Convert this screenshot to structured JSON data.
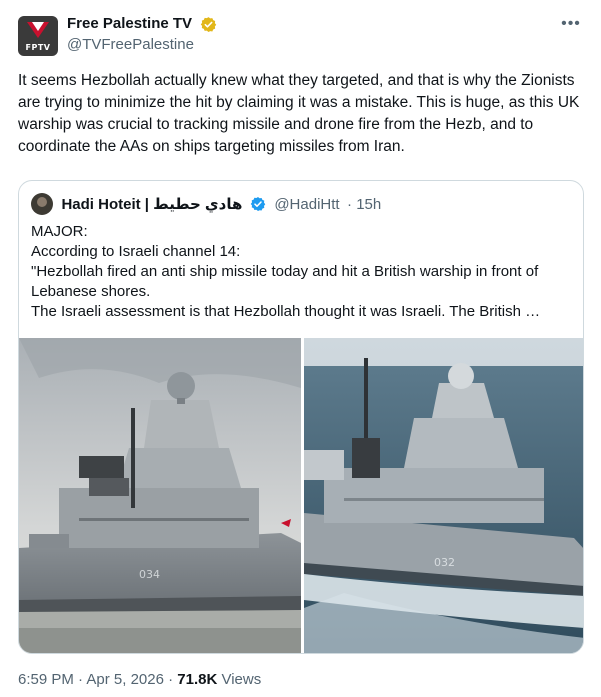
{
  "author": {
    "display_name": "Free Palestine TV",
    "handle": "@TVFreePalestine",
    "avatar_label": "FPTV",
    "verified_color": "#e2b719"
  },
  "tweet": {
    "text": "It seems Hezbollah actually knew what they targeted, and that is why the Zionists are trying to minimize the hit by claiming it was a mistake. This is huge, as this UK warship was crucial to tracking missile and drone fire from the Hezb, and to coordinate the AAs on ships targeting missiles from Iran.",
    "more_icon": "ellipsis-icon"
  },
  "quoted_tweet": {
    "display_name": "Hadi Hoteit | هادي حطيط",
    "handle": "@HadiHtt",
    "time": "· 15h",
    "verified_color": "#1d9bf0",
    "lines": [
      "MAJOR:",
      "According to Israeli channel 14:",
      "\"Hezbollah fired an anti ship missile today and hit a British warship in front of Lebanese shores.",
      "The Israeli assessment is that Hezbollah thought it was Israeli. The British …"
    ],
    "images": [
      {
        "name": "warship-photo-harbor",
        "hull_number": "034"
      },
      {
        "name": "warship-photo-at-sea",
        "hull_number": "032"
      }
    ]
  },
  "footer": {
    "time": "6:59 PM",
    "sep1": " · ",
    "date": "Apr 5, 2026",
    "sep2": " · ",
    "views_count": "71.8K",
    "views_label": " Views"
  }
}
